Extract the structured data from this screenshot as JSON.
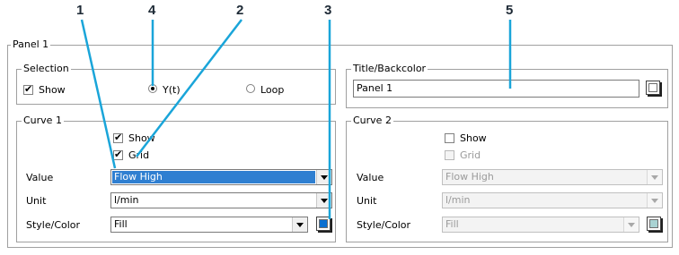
{
  "callouts": {
    "c1": "1",
    "c2": "2",
    "c3": "3",
    "c4": "4",
    "c5": "5",
    "color": "#1aa5d9"
  },
  "panel": {
    "title": "Panel 1"
  },
  "selection": {
    "legend": "Selection",
    "show_label": "Show",
    "show_checked": true,
    "radio_yt_label": "Y(t)",
    "radio_yt_selected": true,
    "radio_loop_label": "Loop",
    "radio_loop_selected": false
  },
  "title_backcolor": {
    "legend": "Title/Backcolor",
    "value": "Panel 1",
    "swatch_color": "#ffffff"
  },
  "curve1": {
    "legend": "Curve 1",
    "show_label": "Show",
    "show_checked": true,
    "grid_label": "Grid",
    "grid_checked": true,
    "value_label": "Value",
    "value_selected": "Flow High",
    "unit_label": "Unit",
    "unit_selected": "l/min",
    "style_label": "Style/Color",
    "style_selected": "Fill",
    "color": "#0a6fd0"
  },
  "curve2": {
    "legend": "Curve 2",
    "show_label": "Show",
    "show_checked": false,
    "grid_label": "Grid",
    "grid_checked": false,
    "value_label": "Value",
    "value_selected": "Flow High",
    "unit_label": "Unit",
    "unit_selected": "l/min",
    "style_label": "Style/Color",
    "style_selected": "Fill",
    "color": "#a9d3d3"
  },
  "colors": {
    "accent_highlight": "#2f7fd1",
    "border": "#a0a0a0",
    "disabled_text": "#9a9a9a"
  }
}
